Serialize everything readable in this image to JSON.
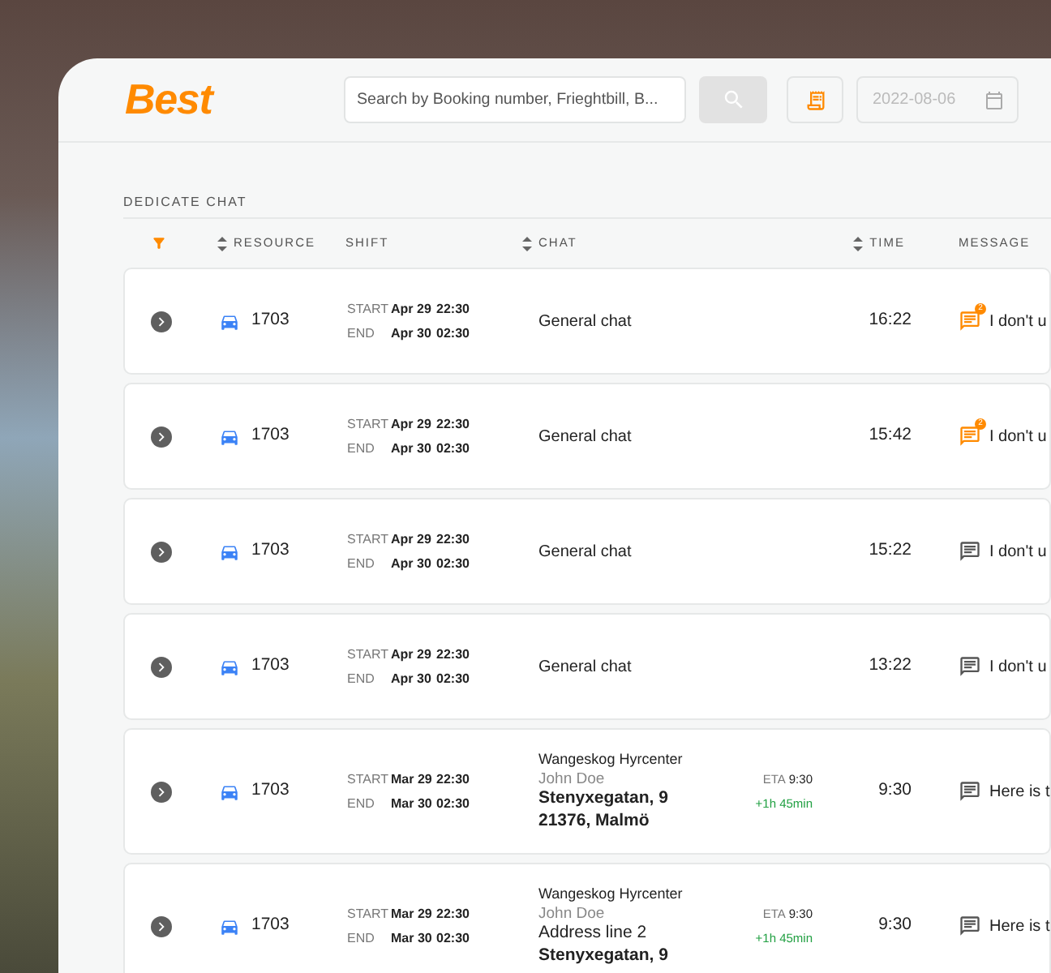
{
  "logo": "Best",
  "search": {
    "placeholder": "Search by Booking number, Frieghtbill, B..."
  },
  "date_field": {
    "placeholder": "2022-08-06"
  },
  "section_title": "DEDICATE CHAT",
  "columns": [
    {
      "label": "RESOURCE",
      "sortable": true
    },
    {
      "label": "SHIFT",
      "sortable": false
    },
    {
      "label": "CHAT",
      "sortable": true
    },
    {
      "label": "TIME",
      "sortable": true
    },
    {
      "label": "MESSAGE",
      "sortable": false
    }
  ],
  "rows": [
    {
      "resource": "1703",
      "shift": {
        "start_label": "START",
        "start_date": "Apr 29",
        "start_time": "22:30",
        "end_label": "END",
        "end_date": "Apr 30",
        "end_time": "02:30"
      },
      "chat": {
        "kind": "general",
        "title": "General chat"
      },
      "time": "16:22",
      "message": {
        "text": "I don't u",
        "unread": true,
        "badge": "2"
      }
    },
    {
      "resource": "1703",
      "shift": {
        "start_label": "START",
        "start_date": "Apr 29",
        "start_time": "22:30",
        "end_label": "END",
        "end_date": "Apr 30",
        "end_time": "02:30"
      },
      "chat": {
        "kind": "general",
        "title": "General chat"
      },
      "time": "15:42",
      "message": {
        "text": "I don't u",
        "unread": true,
        "badge": "2"
      }
    },
    {
      "resource": "1703",
      "shift": {
        "start_label": "START",
        "start_date": "Apr 29",
        "start_time": "22:30",
        "end_label": "END",
        "end_date": "Apr 30",
        "end_time": "02:30"
      },
      "chat": {
        "kind": "general",
        "title": "General chat"
      },
      "time": "15:22",
      "message": {
        "text": "I don't u",
        "unread": false
      }
    },
    {
      "resource": "1703",
      "shift": {
        "start_label": "START",
        "start_date": "Apr 29",
        "start_time": "22:30",
        "end_label": "END",
        "end_date": "Apr 30",
        "end_time": "02:30"
      },
      "chat": {
        "kind": "general",
        "title": "General chat"
      },
      "time": "13:22",
      "message": {
        "text": "I don't u",
        "unread": false
      }
    },
    {
      "resource": "1703",
      "shift": {
        "start_label": "START",
        "start_date": "Mar 29",
        "start_time": "22:30",
        "end_label": "END",
        "end_date": "Mar 30",
        "end_time": "02:30"
      },
      "chat": {
        "kind": "address",
        "company": "Wangeskog Hyrcenter",
        "contact": "John Doe",
        "lines": [
          {
            "text": "Stenyxegatan, 9",
            "bold": true
          },
          {
            "text": "21376, Malmö",
            "bold": true
          }
        ]
      },
      "eta": {
        "label": "ETA",
        "time": "9:30",
        "delta": "+1h 45min"
      },
      "time": "9:30",
      "message": {
        "text": "Here is t",
        "unread": false
      }
    },
    {
      "resource": "1703",
      "shift": {
        "start_label": "START",
        "start_date": "Mar 29",
        "start_time": "22:30",
        "end_label": "END",
        "end_date": "Mar 30",
        "end_time": "02:30"
      },
      "chat": {
        "kind": "address",
        "company": "Wangeskog Hyrcenter",
        "contact": "John Doe",
        "lines": [
          {
            "text": "Address line 2",
            "bold": false
          },
          {
            "text": "Stenyxegatan, 9",
            "bold": true
          }
        ]
      },
      "eta": {
        "label": "ETA",
        "time": "9:30",
        "delta": "+1h 45min"
      },
      "time": "9:30",
      "message": {
        "text": "Here is t",
        "unread": false
      }
    }
  ]
}
